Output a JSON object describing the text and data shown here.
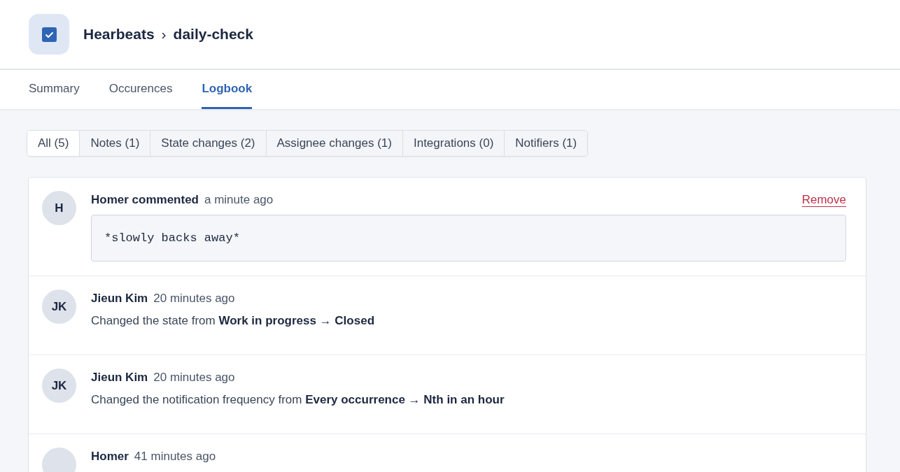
{
  "header": {
    "title": "Hearbeats",
    "separator": "›",
    "subtitle": "daily-check"
  },
  "tabs": [
    {
      "label": "Summary",
      "selected": false
    },
    {
      "label": "Occurences",
      "selected": false
    },
    {
      "label": "Logbook",
      "selected": true
    }
  ],
  "filters": [
    {
      "label": "All (5)",
      "selected": true
    },
    {
      "label": "Notes (1)",
      "selected": false
    },
    {
      "label": "State changes (2)",
      "selected": false
    },
    {
      "label": "Assignee changes (1)",
      "selected": false
    },
    {
      "label": "Integrations (0)",
      "selected": false
    },
    {
      "label": "Notifiers (1)",
      "selected": false
    }
  ],
  "entries": [
    {
      "kind": "comment",
      "initials": "H",
      "author": "Homer commented",
      "time": "a minute ago",
      "action": "Remove",
      "body": "*slowly backs away*"
    },
    {
      "kind": "change",
      "initials": "JK",
      "author": "Jieun Kim",
      "time": "20 minutes ago",
      "message": "Changed the state from **Work in progress → Closed**"
    },
    {
      "kind": "change",
      "initials": "JK",
      "author": "Jieun Kim",
      "time": "20 minutes ago",
      "message": "Changed the notification frequency from **Every occurrence → Nth in an hour**"
    },
    {
      "kind": "change",
      "author": "Homer",
      "time": "41 minutes ago"
    }
  ]
}
